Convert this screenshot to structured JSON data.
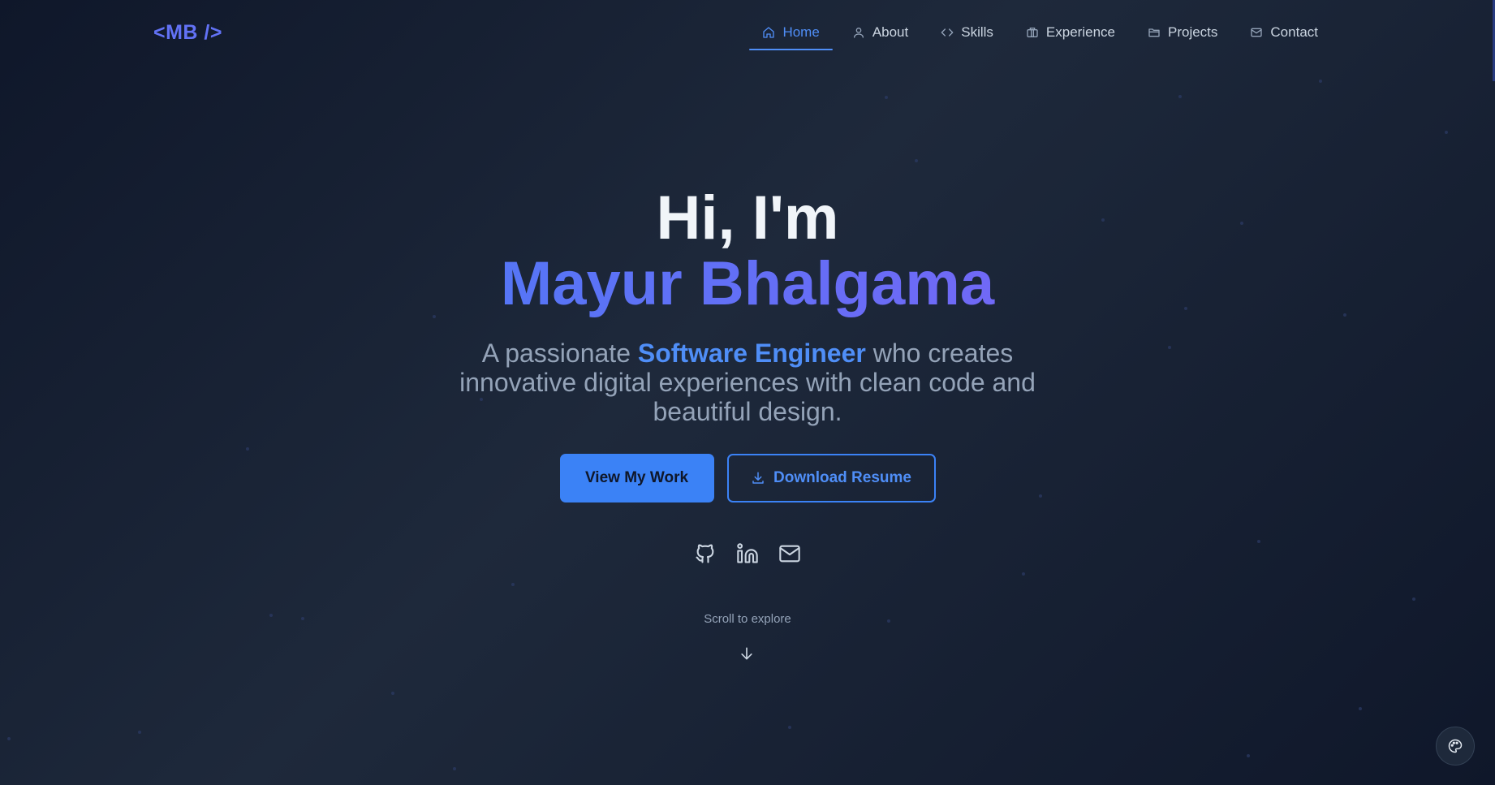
{
  "brand": {
    "logo": "<MB />"
  },
  "nav": {
    "items": [
      {
        "label": "Home",
        "icon": "home-icon",
        "active": true
      },
      {
        "label": "About",
        "icon": "user-icon"
      },
      {
        "label": "Skills",
        "icon": "code-icon"
      },
      {
        "label": "Experience",
        "icon": "briefcase-icon"
      },
      {
        "label": "Projects",
        "icon": "folder-icon"
      },
      {
        "label": "Contact",
        "icon": "mail-icon"
      }
    ]
  },
  "hero": {
    "greeting": "Hi, I'm",
    "name": "Mayur Bhalgama",
    "tagline_prefix": "A passionate ",
    "tagline_highlight": "Software Engineer",
    "tagline_suffix": " who creates innovative digital experiences with clean code and beautiful design.",
    "primary_button": "View My Work",
    "secondary_button": "Download Resume",
    "socials": [
      "github-icon",
      "linkedin-icon",
      "mail-icon"
    ]
  },
  "scroll": {
    "label": "Scroll to explore"
  },
  "colors": {
    "accent": "#3b82f6",
    "gradient_start": "#3b82f6",
    "gradient_end": "#8b5cf6",
    "background": "#0f172a"
  }
}
